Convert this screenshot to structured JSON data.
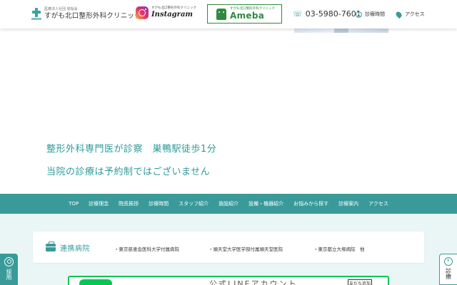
{
  "header": {
    "logo_small": "医療法人社団 俊桜会",
    "logo_main": "すがも北口整形外科クリニック",
    "instagram_small": "すがも北口整形外科クリニック",
    "instagram_name": "Instagram",
    "ameba_small": "すがも北口整形外科クリニック",
    "ameba_name": "Ameba",
    "phone": "03-5980-7601",
    "hours_label": "診療時間",
    "access_label": "アクセス",
    "icons": [
      "cross-logo-icon",
      "instagram-icon",
      "ameba-icon",
      "phone-icon",
      "clock-icon",
      "map-pin-icon"
    ]
  },
  "hero": {
    "headline1": "整形外科専門医が診察　巣鴨駅徒歩1分",
    "headline2": "当院の診療は予約制ではございません"
  },
  "nav": {
    "items": [
      {
        "label": "TOP"
      },
      {
        "label": "診療理念"
      },
      {
        "label": "院長挨拶"
      },
      {
        "label": "診療時間"
      },
      {
        "label": "スタッフ紹介"
      },
      {
        "label": "施設紹介"
      },
      {
        "label": "設備・機器紹介"
      },
      {
        "label": "お悩みから探す"
      },
      {
        "label": "診療案内"
      },
      {
        "label": "アクセス"
      }
    ]
  },
  "partners": {
    "title": "連携病院",
    "hospitals": [
      "・東京慈恵会医科大学付属病院",
      "・順天堂大学医学部付属順天堂医院",
      "・東京都立大塚病院　他"
    ]
  },
  "side": {
    "left_label": "採用",
    "right_label": "診療"
  },
  "line_banner": {
    "text": "公式LINEアカウント",
    "badge": "友だち追加"
  },
  "colors": {
    "accent": "#3a9a9a",
    "headline": "#2f9a9a",
    "lower_bg": "#eaf6f6",
    "ameba_green": "#2e8b3e",
    "line_green": "#06c755"
  }
}
